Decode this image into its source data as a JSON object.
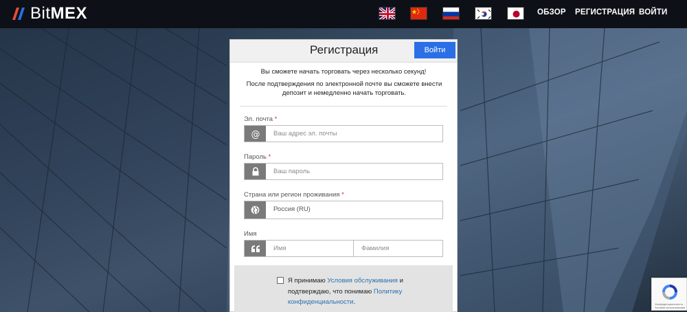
{
  "brand": {
    "name_light": "Bit",
    "name_bold": "MEX",
    "accent": "#2a6fe6"
  },
  "header": {
    "flags": [
      "uk-flag-icon",
      "china-flag-icon",
      "russia-flag-icon",
      "korea-flag-icon",
      "japan-flag-icon"
    ],
    "nav": {
      "overview": "ОБЗОР",
      "register": "РЕГИСТРАЦИЯ",
      "login": "ВОЙТИ"
    }
  },
  "form": {
    "title": "Регистрация",
    "login_button": "Войти",
    "intro_line1": "Вы сможете начать торговать через несколько секунд!",
    "intro_line2": "После подтверждения по электронной почте вы сможете внести депозит и немедленно начать торговать.",
    "email": {
      "label": "Эл. почта",
      "required_mark": "*",
      "placeholder": "Ваш адрес эл. почты",
      "icon": "at-icon"
    },
    "password": {
      "label": "Пароль",
      "required_mark": "*",
      "placeholder": "Ваш пароль",
      "icon": "lock-icon"
    },
    "country": {
      "label": "Страна или регион проживания",
      "required_mark": "*",
      "value": "Россия (RU)",
      "icon": "globe-icon"
    },
    "name": {
      "label": "Имя",
      "first_placeholder": "Имя",
      "last_placeholder": "Фамилия",
      "icon": "quote-icon"
    },
    "agree": {
      "prefix": "Я принимаю",
      "terms_link": "Условия обслуживания",
      "middle": "и подтверждаю, что понимаю",
      "privacy_link": "Политику конфиденциальности",
      "suffix": "."
    }
  },
  "recaptcha": {
    "text": "Конфиденциальность - Условия использования"
  }
}
